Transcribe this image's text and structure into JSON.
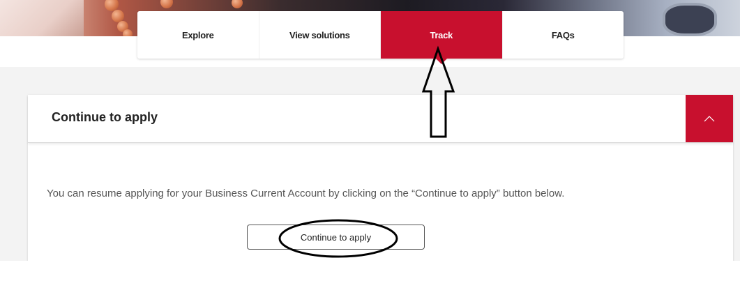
{
  "tabs": [
    {
      "label": "Explore",
      "active": false
    },
    {
      "label": "View solutions",
      "active": false
    },
    {
      "label": "Track",
      "active": true
    },
    {
      "label": "FAQs",
      "active": false
    }
  ],
  "accordion": {
    "title": "Continue to apply",
    "toggle_icon": "chevron-up-icon",
    "expanded": true,
    "body_text": "You can resume applying for your Business Current Account by clicking on the “Continue to apply” button below.",
    "button_label": "Continue to apply"
  },
  "annotations": {
    "arrow_icon": "up-arrow-annotation",
    "ellipse_icon": "ellipse-annotation"
  },
  "colors": {
    "brand_red": "#c8102e",
    "page_grey": "#f3f3f3",
    "text_dark": "#222222",
    "text_body": "#555555"
  }
}
